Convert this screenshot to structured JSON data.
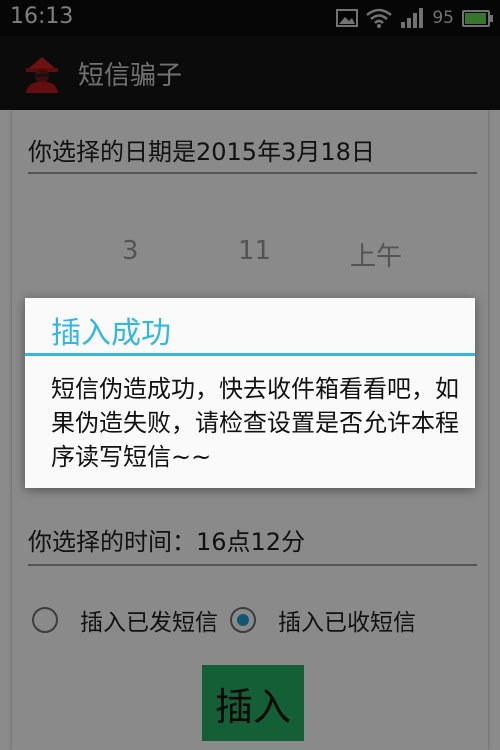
{
  "status_bar": {
    "time": "16:13",
    "battery_level_text": "95",
    "battery_fraction": 0.95,
    "icons": [
      "image-icon",
      "wifi-icon",
      "signal-icon",
      "battery-icon"
    ]
  },
  "action_bar": {
    "title": "短信骗子",
    "icon": "spy-app-icon"
  },
  "form": {
    "date_text": "你选择的日期是2015年3月18日",
    "picker": {
      "hour": "3",
      "minute": "11",
      "ampm": "上午"
    },
    "time_text": "你选择的时间：16点12分",
    "radio_sent_label": "插入已发短信",
    "radio_received_label": "插入已收短信",
    "selected_option": "received",
    "insert_label": "插入"
  },
  "dialog": {
    "title": "插入成功",
    "message": "短信伪造成功，快去收件箱看看吧，如果伪造失败，请检查设置是否允许本程序读写短信~~"
  },
  "colors": {
    "accent_blue": "#33b5e5",
    "radio_blue": "#1e9fd6",
    "insert_green": "#27ad63",
    "battery_green": "#5fd84d"
  }
}
